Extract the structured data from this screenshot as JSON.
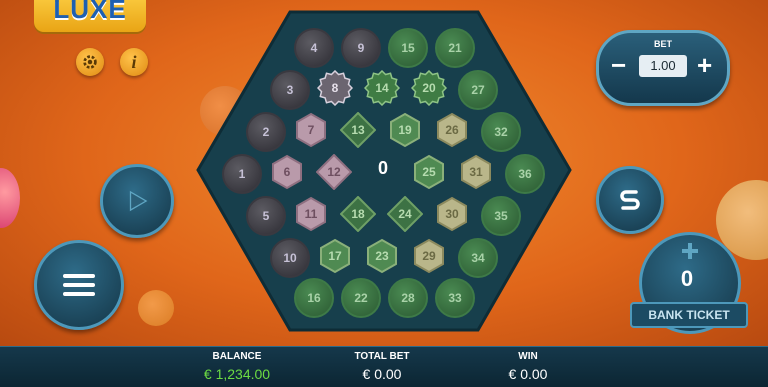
{
  "logo": {
    "text": "LUXE"
  },
  "controls": {
    "settings_icon": "gear-icon",
    "info_icon": "info-icon",
    "info_glyph": "i",
    "play_icon": "play-icon",
    "menu_icon": "hamburger-menu-icon",
    "swap_icon": "s-swap-icon"
  },
  "board": {
    "center_number": "0",
    "balls": [
      {
        "n": "4",
        "style": "dark"
      },
      {
        "n": "9",
        "style": "dark"
      },
      {
        "n": "15",
        "style": "green"
      },
      {
        "n": "21",
        "style": "green"
      },
      {
        "n": "3",
        "style": "dark"
      },
      {
        "n": "8",
        "style": "burst"
      },
      {
        "n": "14",
        "style": "greenburst"
      },
      {
        "n": "20",
        "style": "greenburst"
      },
      {
        "n": "27",
        "style": "green"
      },
      {
        "n": "2",
        "style": "dark"
      },
      {
        "n": "7",
        "style": "pinkhex"
      },
      {
        "n": "13",
        "style": "greendiamond"
      },
      {
        "n": "19",
        "style": "greenhex"
      },
      {
        "n": "26",
        "style": "lighthex"
      },
      {
        "n": "32",
        "style": "green"
      },
      {
        "n": "1",
        "style": "dark"
      },
      {
        "n": "6",
        "style": "pinkhex"
      },
      {
        "n": "12",
        "style": "pinkdiamond"
      },
      {
        "n": "25",
        "style": "greenhex"
      },
      {
        "n": "31",
        "style": "lighthex"
      },
      {
        "n": "36",
        "style": "green"
      },
      {
        "n": "5",
        "style": "dark"
      },
      {
        "n": "11",
        "style": "pinkhex"
      },
      {
        "n": "18",
        "style": "greendiamond"
      },
      {
        "n": "24",
        "style": "greendiamond"
      },
      {
        "n": "30",
        "style": "lighthex"
      },
      {
        "n": "35",
        "style": "green"
      },
      {
        "n": "10",
        "style": "dark"
      },
      {
        "n": "17",
        "style": "greenhex"
      },
      {
        "n": "23",
        "style": "greenhex"
      },
      {
        "n": "29",
        "style": "lighthex"
      },
      {
        "n": "34",
        "style": "green"
      },
      {
        "n": "16",
        "style": "green"
      },
      {
        "n": "22",
        "style": "green"
      },
      {
        "n": "28",
        "style": "green"
      },
      {
        "n": "33",
        "style": "green"
      }
    ]
  },
  "bet": {
    "label": "BET",
    "value": "1.00",
    "minus": "−",
    "plus": "+"
  },
  "bank_ticket": {
    "count": "0",
    "label": "BANK TICKET"
  },
  "footer": {
    "balance_label": "BALANCE",
    "balance_value": "€ 1,234.00",
    "total_bet_label": "TOTAL BET",
    "total_bet_value": "€ 0.00",
    "win_label": "WIN",
    "win_value": "€ 0.00"
  },
  "colors": {
    "accent": "#6ddc43",
    "panel": "#14384c",
    "board": "#173f4c"
  }
}
